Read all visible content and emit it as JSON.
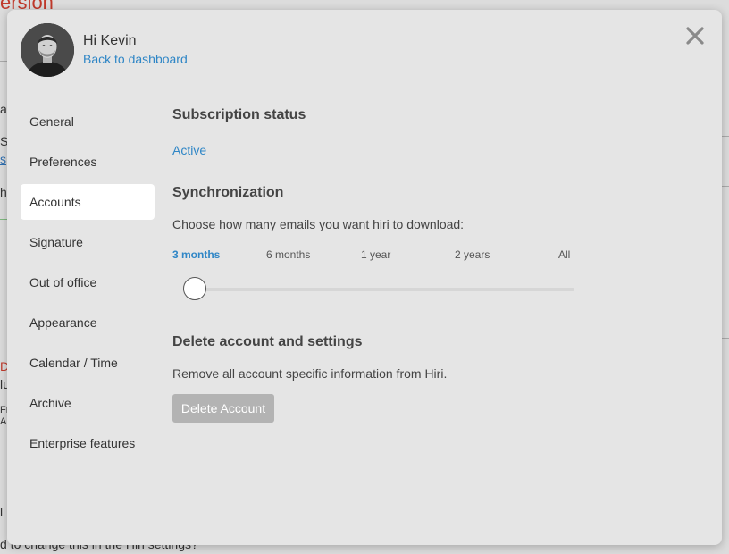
{
  "background": {
    "title_fragment": "ersion",
    "text_fragments": [
      "a",
      "S",
      "s",
      "h",
      "D",
      "lu",
      "Fr",
      "A",
      "l",
      "d to change this in the Hiri settings?"
    ]
  },
  "header": {
    "greeting": "Hi Kevin",
    "back_link": "Back to dashboard"
  },
  "sidebar": {
    "items": [
      {
        "label": "General",
        "active": false
      },
      {
        "label": "Preferences",
        "active": false
      },
      {
        "label": "Accounts",
        "active": true
      },
      {
        "label": "Signature",
        "active": false
      },
      {
        "label": "Out of office",
        "active": false
      },
      {
        "label": "Appearance",
        "active": false
      },
      {
        "label": "Calendar / Time",
        "active": false
      },
      {
        "label": "Archive",
        "active": false
      },
      {
        "label": "Enterprise features",
        "active": false
      }
    ]
  },
  "subscription": {
    "heading": "Subscription status",
    "status": "Active"
  },
  "sync": {
    "heading": "Synchronization",
    "description": "Choose how many emails you want hiri to download:",
    "options": [
      "3 months",
      "6 months",
      "1 year",
      "2 years",
      "All"
    ],
    "selected_index": 0,
    "slider_value_fraction": 0
  },
  "delete": {
    "heading": "Delete account and settings",
    "description": "Remove all account specific information from Hiri.",
    "button_label": "Delete Account"
  },
  "icons": {
    "close": "close-icon",
    "avatar": "avatar"
  },
  "colors": {
    "link": "#2f86c6",
    "modal_bg": "#e5e5e5",
    "active_item_bg": "#ffffff",
    "delete_button_bg": "#b3b3b3"
  }
}
